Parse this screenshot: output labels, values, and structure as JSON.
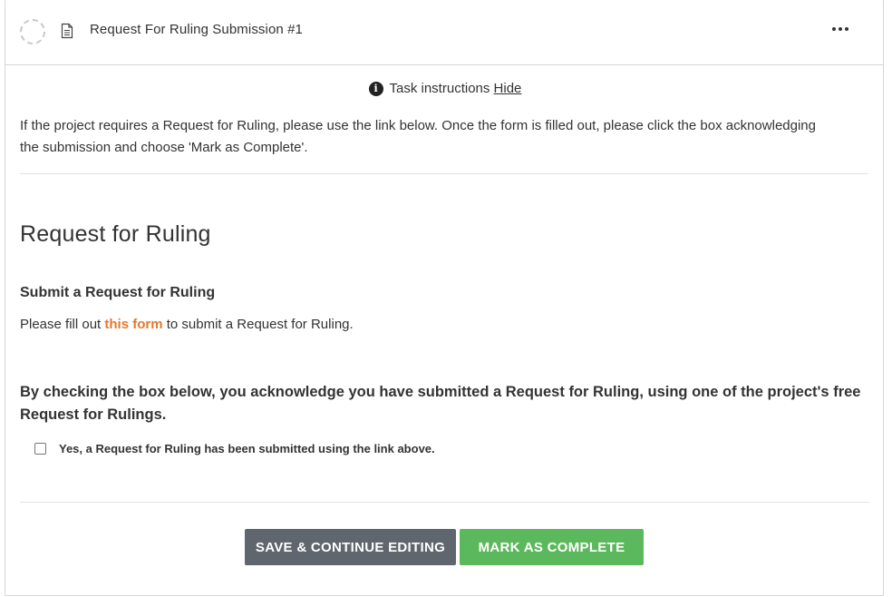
{
  "header": {
    "title": "Request For Ruling Submission #1"
  },
  "instructions": {
    "toggle_label": "Task instructions",
    "hide_label": "Hide",
    "text": "If the project requires a Request for Ruling, please use the link below. Once the form is filled out, please click the box acknowledging the submission and choose 'Mark as Complete'."
  },
  "form": {
    "title": "Request for Ruling",
    "section_heading": "Submit a Request for Ruling",
    "desc_prefix": "Please fill out ",
    "desc_link": "this form",
    "desc_suffix": " to submit a Request for Ruling.",
    "ack_heading": "By checking the box below, you acknowledge you have submitted a Request for Ruling, using one of the project's free Request for Rulings.",
    "checkbox_label": "Yes, a Request for Ruling has been submitted using the link above.",
    "checkbox_checked": false
  },
  "actions": {
    "save_label": "SAVE & CONTINUE EDITING",
    "complete_label": "MARK AS COMPLETE"
  },
  "colors": {
    "link": "#e07a2f",
    "save_button": "#5f666d",
    "complete_button": "#5cb85c"
  }
}
